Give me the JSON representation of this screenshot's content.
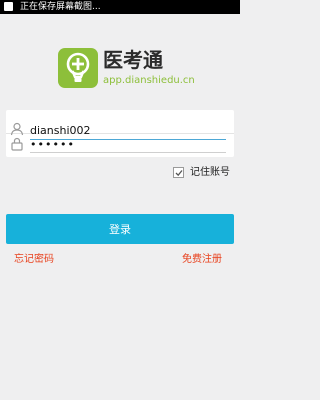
{
  "status_bar": {
    "text": "正在保存屏幕截图..."
  },
  "brand": {
    "name": "医考通",
    "domain": "app.dianshiedu.cn",
    "logo_icon": "lightbulb-plus-icon",
    "logo_color": "#8dbf3a"
  },
  "login_form": {
    "username_value": "dianshi002",
    "password_value": "••••••",
    "remember_label": "记住账号",
    "remember_checked": true,
    "login_label": "登录"
  },
  "links": {
    "forgot_password": "忘记密码",
    "register": "免费注册"
  },
  "colors": {
    "accent": "#17b1da",
    "link": "#e8401c",
    "background": "#efeff0"
  }
}
